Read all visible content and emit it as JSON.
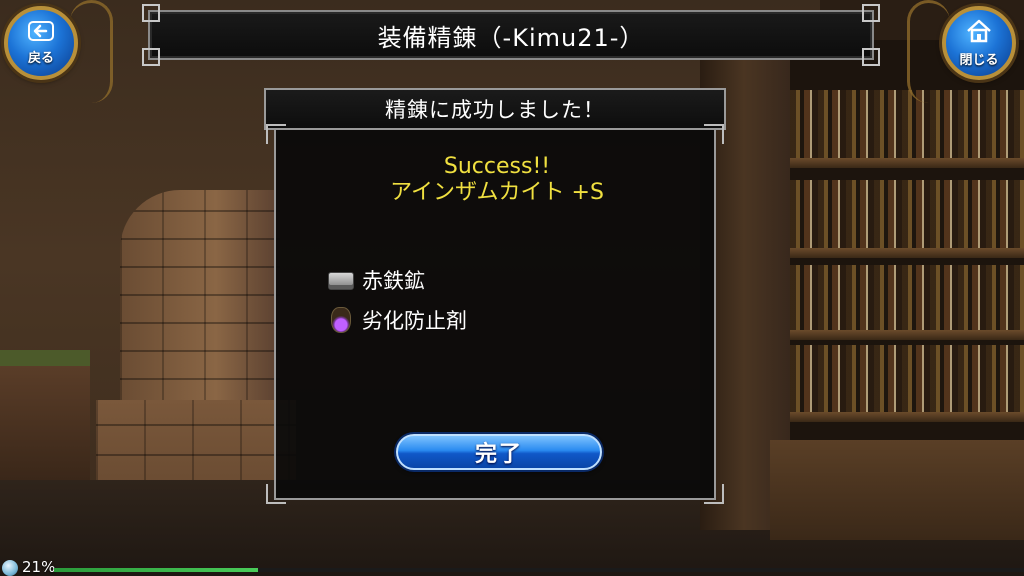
{
  "header": {
    "title": "装備精錬（-Kimu21-）",
    "back_label": "戻る",
    "close_label": "閉じる"
  },
  "dialog": {
    "heading": "精錬に成功しました！",
    "result_line1": "Success!!",
    "result_line2": "アインザムカイト +S",
    "materials": [
      {
        "icon": "ore-icon",
        "label": "赤鉄鉱"
      },
      {
        "icon": "potion-icon",
        "label": "劣化防止剤"
      }
    ],
    "done_label": "完了"
  },
  "status": {
    "percent_text": "21%",
    "progress_fraction": 0.21
  },
  "colors": {
    "result_text": "#f0e040",
    "button_blue": "#1c73d6",
    "frame_gold": "#b8903a"
  }
}
